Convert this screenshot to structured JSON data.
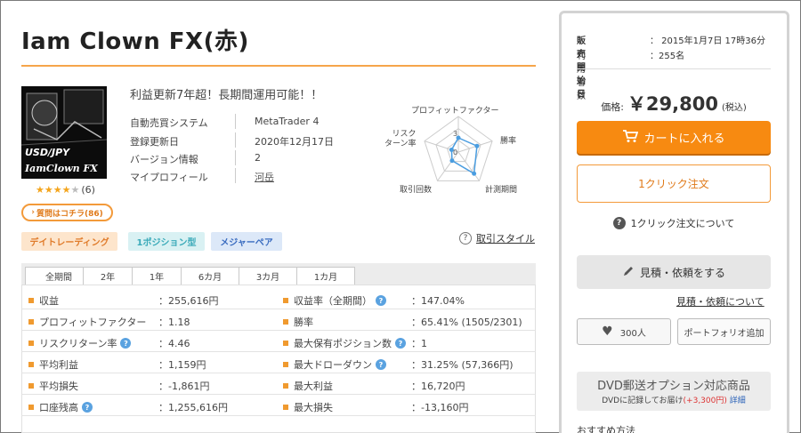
{
  "product": {
    "title": "Iam Clown FX(赤)",
    "headline": "利益更新7年超！長期間運用可能！！",
    "image_text": [
      "USD/JPY",
      "IamClown FX"
    ],
    "rating_stars": 4,
    "rating_count": "(6)",
    "question_button": "質問はコチラ(86)"
  },
  "specs": [
    {
      "label": "自動売買システム",
      "value": "MetaTrader 4"
    },
    {
      "label": "登録更新日",
      "value": "2020年12月17日"
    },
    {
      "label": "バージョン情報",
      "value": "2"
    },
    {
      "label": "マイプロフィール",
      "value": "河岳"
    }
  ],
  "radar": {
    "labels": {
      "top": "プロフィットファクター",
      "right": "勝率",
      "bottom_right": "計測期間",
      "bottom_left": "取引回数",
      "left": "リスク\nターン率"
    },
    "scale_labels": [
      "3",
      "0"
    ],
    "values": [
      0.4,
      0.55,
      0.75,
      0.3,
      0.2
    ]
  },
  "tags": [
    "デイトレーディング",
    "1ポジション型",
    "メジャーペア"
  ],
  "style_link": "取引スタイル",
  "period_tabs": [
    "全期間",
    "2年",
    "1年",
    "6カ月",
    "3カ月",
    "1カ月"
  ],
  "active_tab": 0,
  "stats": [
    {
      "label": "収益",
      "value": "：255,616円",
      "help": false
    },
    {
      "label": "収益率（全期間）",
      "value": "：147.04%",
      "help": true
    },
    {
      "label": "プロフィットファクター",
      "value": "：1.18",
      "help": false
    },
    {
      "label": "勝率",
      "value": "：65.41% (1505/2301)",
      "help": false
    },
    {
      "label": "リスクリターン率",
      "value": "：4.46",
      "help": true
    },
    {
      "label": "最大保有ポジション数",
      "value": "：1",
      "help": true
    },
    {
      "label": "平均利益",
      "value": "：1,159円",
      "help": false
    },
    {
      "label": "最大ドローダウン",
      "value": "：31.25% (57,366円)",
      "help": true
    },
    {
      "label": "平均損失",
      "value": "：-1,861円",
      "help": false
    },
    {
      "label": "最大利益",
      "value": "：16,720円",
      "help": false
    },
    {
      "label": "口座残高",
      "value": "：1,255,616円",
      "help": true
    },
    {
      "label": "最大損失",
      "value": "：-13,160円",
      "help": false
    }
  ],
  "sidebar": {
    "start_label": "販売開始日",
    "start_value": "：  2015年1月7日 17時36分",
    "users_label": "利用者数",
    "users_value": "：255名",
    "price_label": "価格:",
    "price_value": "￥29,800",
    "price_tax": "(税込)",
    "cart_button": "カートに入れる",
    "oneclick_button": "1クリック注文",
    "about_oneclick": "1クリック注文について",
    "quote_button": "見積・依頼をする",
    "quote_link": "見積・依頼について",
    "fav_count": "300人",
    "portfolio_button": "ポートフォリオ追加",
    "dvd_title": "DVD郵送オプション対応商品",
    "dvd_sub_prefix": "DVDに記録してお届け",
    "dvd_sub_price": "(+3,300円)",
    "dvd_sub_link": "詳細",
    "cut_text": "おすすめ方法"
  },
  "colors": {
    "accent_orange": "#f78a11",
    "title_rule": "#f6a54a",
    "help_blue": "#5aa2e0",
    "stat_square": "#f09a2f"
  }
}
